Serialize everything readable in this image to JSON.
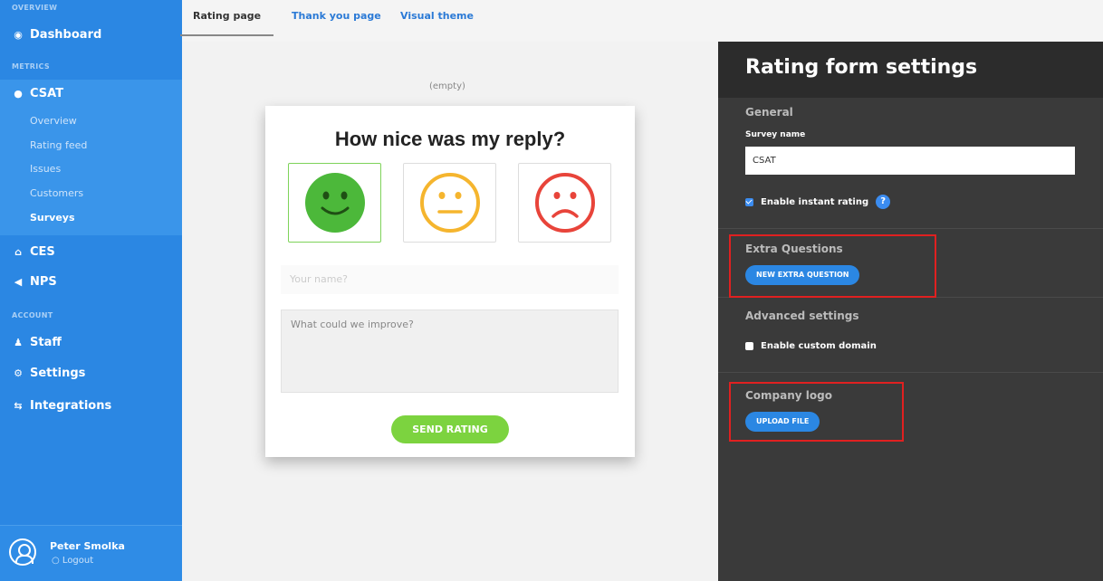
{
  "sidebar": {
    "overview_section": "OVERVIEW",
    "dashboard": "Dashboard",
    "metrics_section": "METRICS",
    "csat": "CSAT",
    "csat_items": [
      "Overview",
      "Rating feed",
      "Issues",
      "Customers",
      "Surveys"
    ],
    "ces": "CES",
    "nps": "NPS",
    "account_section": "ACCOUNT",
    "staff": "Staff",
    "settings": "Settings",
    "integrations": "Integrations",
    "user_name": "Peter Smolka",
    "logout": "Logout"
  },
  "tabs": [
    "Rating page",
    "Thank you page",
    "Visual theme"
  ],
  "preview": {
    "empty_label": "(empty)",
    "title": "How nice was my reply?",
    "name_placeholder": "Your name?",
    "improve_placeholder": "What could we improve?",
    "send_label": "SEND RATING"
  },
  "settings_panel": {
    "title": "Rating form settings",
    "general_heading": "General",
    "survey_name_label": "Survey name",
    "survey_name_value": "CSAT",
    "instant_rating_label": "Enable instant rating",
    "help_glyph": "?",
    "extra_questions_heading": "Extra Questions",
    "new_extra_question_label": "NEW EXTRA QUESTION",
    "advanced_heading": "Advanced settings",
    "custom_domain_label": "Enable custom domain",
    "company_logo_heading": "Company logo",
    "upload_label": "UPLOAD FILE"
  },
  "colors": {
    "sidebar": "#2b87e3",
    "accent": "#3b8cf0",
    "happy": "#4cb83a",
    "neutral": "#f5b52e",
    "sad": "#e8443a",
    "send": "#7cd33f",
    "highlight": "#e02020"
  },
  "icons": [
    "dashboard-icon",
    "chat-bubble-icon",
    "ces-icon",
    "megaphone-icon",
    "staff-icon",
    "gear-icon",
    "integrations-icon",
    "user-avatar-icon",
    "power-icon",
    "happy-face-icon",
    "neutral-face-icon",
    "sad-face-icon"
  ]
}
